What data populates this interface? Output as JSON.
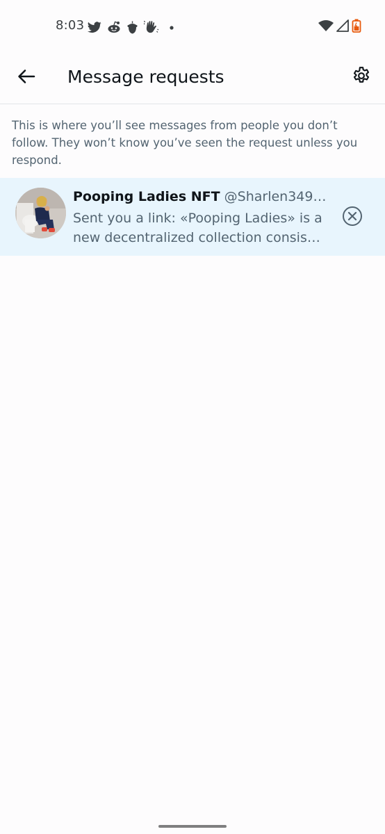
{
  "status_bar": {
    "time": "8:03",
    "notification_icons": [
      "twitter-icon",
      "reddit-icon",
      "acorn-icon",
      "waving-hand-icon",
      "dot-icon"
    ],
    "system_icons": [
      "wifi-icon",
      "signal-icon",
      "battery-icon"
    ],
    "battery_color": "#e8590c"
  },
  "header": {
    "title": "Message requests"
  },
  "info": {
    "text": "This is where you’ll see messages from people you don’t follow. They won’t know you’ve seen the request unless you respond."
  },
  "requests": [
    {
      "name": "Pooping Ladies NFT",
      "handle": "@Sharlen349…",
      "preview_line1": "Sent you a link: «Pooping Ladies» is a",
      "preview_line2": "new decentralized collection consis…"
    }
  ],
  "colors": {
    "request_highlight": "#e8f5fd",
    "secondary_text": "#536471",
    "primary_text": "#0f1419"
  }
}
